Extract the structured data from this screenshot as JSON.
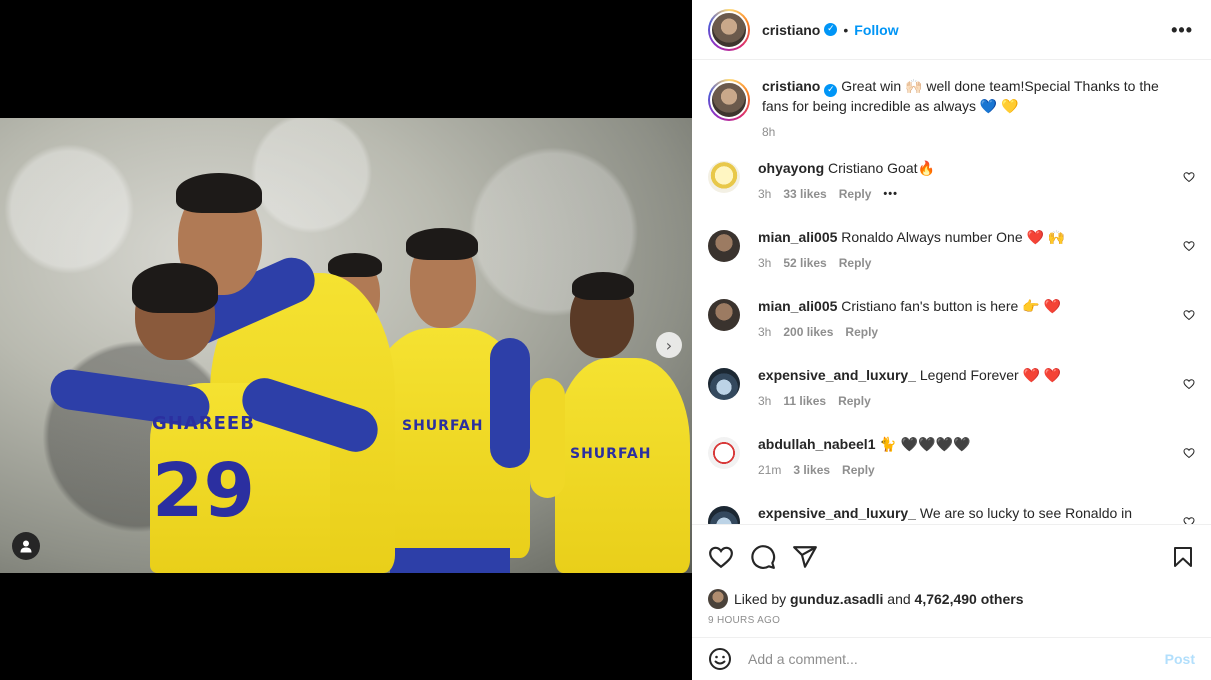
{
  "post": {
    "author": "cristiano",
    "follow_label": "Follow",
    "more_label": "•••",
    "caption": "Great win 🙌🏻 well done team!Special Thanks to the fans for being incredible as always 💙 💛",
    "caption_time": "8h",
    "media": {
      "shirt_sponsor": "SHURFAH",
      "player_name": "GHAREEB",
      "player_number": "29",
      "carousel_dots": 5,
      "active_dot": 1
    }
  },
  "comments": [
    {
      "user": "ohyayong",
      "text": "Cristiano Goat🔥",
      "time": "3h",
      "likes": "33 likes",
      "reply": "Reply",
      "more": "•••"
    },
    {
      "user": "mian_ali005",
      "text": "Ronaldo Always number One ❤️ 🙌",
      "time": "3h",
      "likes": "52 likes",
      "reply": "Reply"
    },
    {
      "user": "mian_ali005",
      "text": "Cristiano fan's button is here 👉 ❤️",
      "time": "3h",
      "likes": "200 likes",
      "reply": "Reply"
    },
    {
      "user": "expensive_and_luxury_",
      "text": "Legend Forever ❤️ ❤️",
      "time": "3h",
      "likes": "11 likes",
      "reply": "Reply"
    },
    {
      "user": "abdullah_nabeel1",
      "text": "🐈 🖤🖤🖤🖤",
      "time": "21m",
      "likes": "3 likes",
      "reply": "Reply"
    },
    {
      "user": "expensive_and_luxury_",
      "text": "We are so lucky to see Ronaldo in"
    }
  ],
  "likes": {
    "prefix": "Liked by",
    "user": "gunduz.asadli",
    "joiner": "and",
    "others": "4,762,490 others"
  },
  "posted_ago": "9 HOURS AGO",
  "add_comment": {
    "placeholder": "Add a comment...",
    "post_label": "Post"
  },
  "colors": {
    "accent": "#0095f6",
    "post_disabled": "#b2dffc",
    "muted": "#8e8e8e",
    "jersey_yellow": "#f5e231",
    "jersey_blue": "#2d3fa8"
  },
  "icons": {
    "tag": "user-icon",
    "next": "chevron-right-icon",
    "like": "heart-icon",
    "comment": "comment-icon",
    "share": "send-icon",
    "save": "bookmark-icon",
    "emoji": "smiley-icon"
  }
}
